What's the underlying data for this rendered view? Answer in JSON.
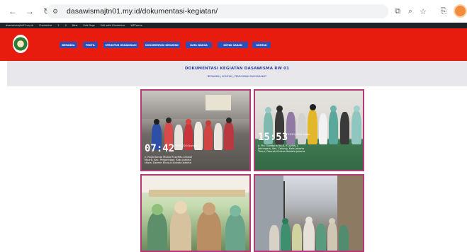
{
  "browser": {
    "url": "dasawismajtn01.my.id/dokumentasi-kegiatan/",
    "icons": [
      "back-icon",
      "forward-icon",
      "reload-icon",
      "site-info-icon",
      "translate-icon",
      "zoom-icon",
      "star-icon",
      "extensions-icon",
      "profile-avatar"
    ]
  },
  "adminbar": {
    "items": [
      "dasawismajtn01.my.id",
      "Customize",
      "1",
      "0",
      "New",
      "Edit Page",
      "Edit with Elementor",
      "WPForms"
    ]
  },
  "header": {
    "menu": [
      "BERANDA",
      "PROFIL",
      "STRUKTUR ORGANISASI",
      "DOKUMENTASI KEGIATAN",
      "DATA WARGA",
      "KOTAK SARAN",
      "KONTAK"
    ],
    "colors": {
      "header_bg": "#e81b0f",
      "menu_bg": "#2f4fb8",
      "photo_border": "#b23a7a"
    }
  },
  "page": {
    "title": "DOKUMENTASI KEGIATAN DASAWISMA RW 01",
    "breadcrumb": "BERANDA | KONTAK | PEMUKIMAN MASYARAKAT"
  },
  "gallery": [
    {
      "time": "07:42",
      "date": "20/12/2024 Jumat",
      "stamp": "Jl. Raya Kamal Muara RT.8/RW.1 Kamal Muara, Kec. Penjaringan, Kota Jakarta Utara, Daerah Khusus Ibukota Jakarta"
    },
    {
      "time": "15:53",
      "date": "23/11/2024 Sabtu",
      "stamp": "Jl. Pln. Gandaria No.8, RT.8/RW.1, Jatinegara, Kec. Cakung, Kota Jakarta Timur, Daerah Khusus Ibukota Jakarta"
    },
    {
      "time": "",
      "date": "",
      "stamp": ""
    },
    {
      "time": "",
      "date": "",
      "stamp": ""
    }
  ]
}
